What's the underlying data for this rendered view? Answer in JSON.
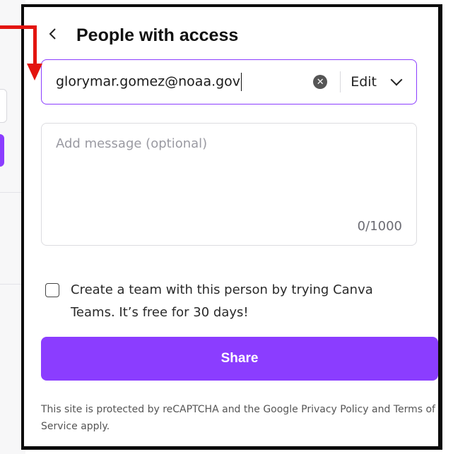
{
  "header": {
    "back_icon": "chevron-left-icon",
    "title": "People with access"
  },
  "invite": {
    "email_value": "glorymar.gomez@noaa.gov",
    "clear_icon": "clear-circle-icon",
    "role_value": "Edit",
    "role_chevron_icon": "chevron-down-icon"
  },
  "message": {
    "placeholder": "Add message (optional)",
    "counter": "0/1000"
  },
  "team_option": {
    "checked": false,
    "label": "Create a team with this person by trying Canva Teams. It’s free for 30 days!"
  },
  "share_button": {
    "label": "Share"
  },
  "legal": {
    "text": "This site is protected by reCAPTCHA and the Google Privacy Policy and Terms of Service apply."
  },
  "colors": {
    "accent": "#8b3dff",
    "annotation_arrow": "#e3140f",
    "panel_border": "#0b0b0b"
  }
}
